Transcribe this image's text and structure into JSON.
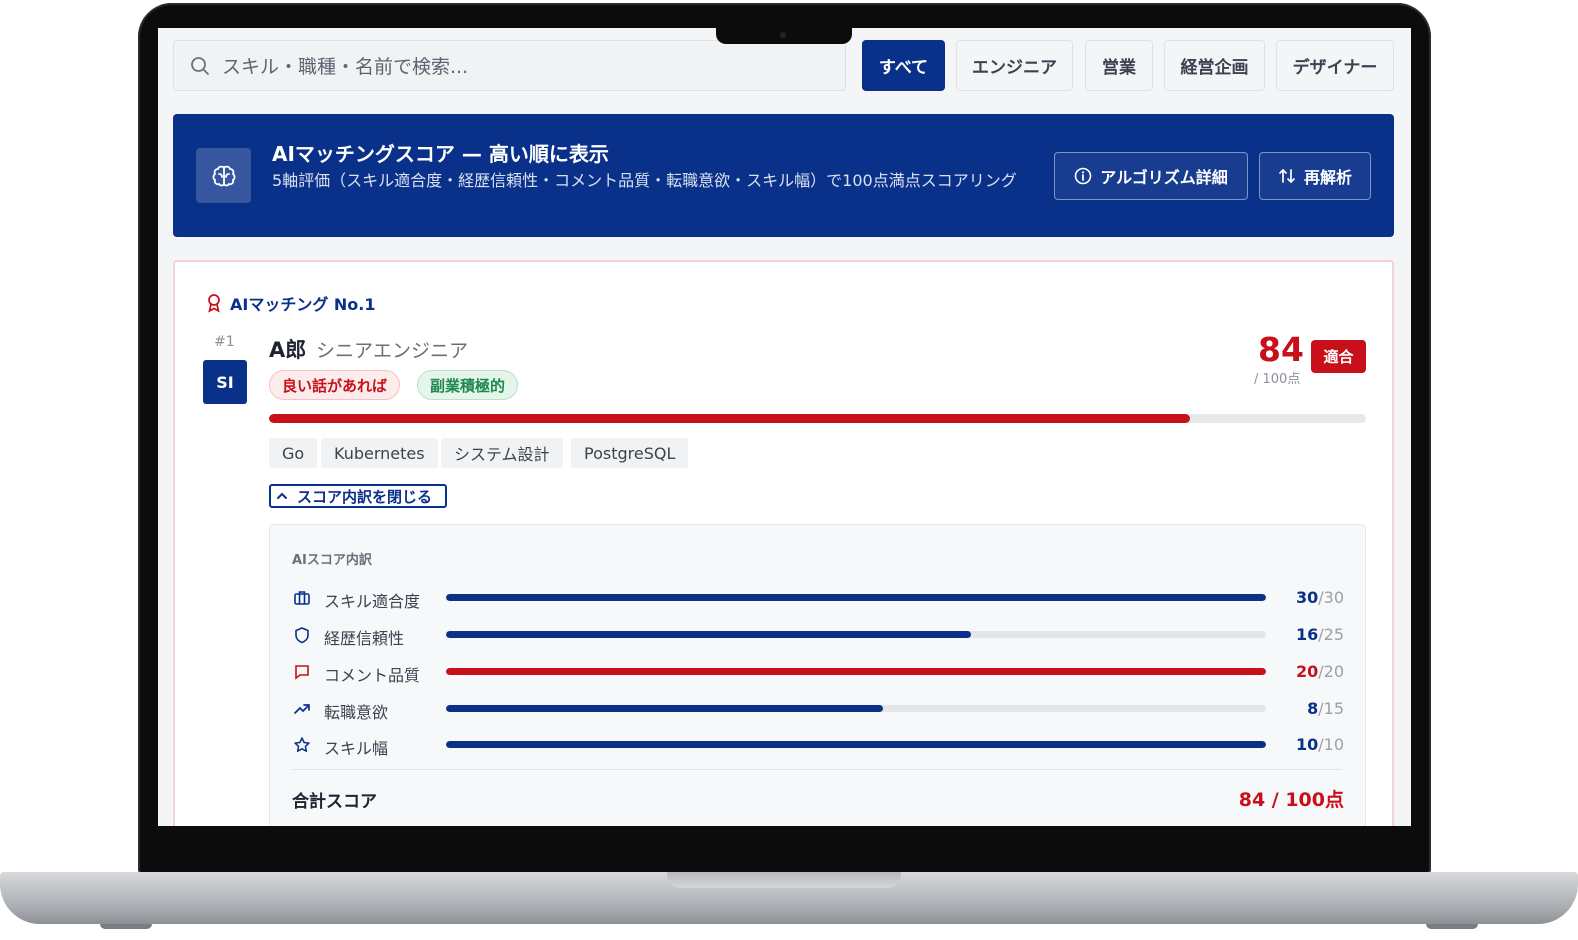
{
  "search": {
    "placeholder": "スキル・職種・名前で検索..."
  },
  "filters": [
    {
      "label": "すべて",
      "active": true
    },
    {
      "label": "エンジニア",
      "active": false
    },
    {
      "label": "営業",
      "active": false
    },
    {
      "label": "経営企画",
      "active": false
    },
    {
      "label": "デザイナー",
      "active": false
    }
  ],
  "banner": {
    "icon": "brain-icon",
    "title": "AIマッチングスコア — 高い順に表示",
    "subtitle": "5軸評価（スキル適合度・経歴信頼性・コメント品質・転職意欲・スキル幅）で100点満点スコアリング",
    "algorithm_button": "アルゴリズム詳細",
    "reanalyze_button": "再解析"
  },
  "candidate": {
    "badge_label": "AIマッチング No.1",
    "rank": "#1",
    "avatar_initials": "SI",
    "name": "A郎",
    "role": "シニアエンジニア",
    "tags": [
      "良い話があれば",
      "副業積極的"
    ],
    "score": "84",
    "score_max": "/ 100点",
    "score_fraction": 0.84,
    "fit_label": "適合",
    "skills": [
      "Go",
      "Kubernetes",
      "システム設計",
      "PostgreSQL"
    ],
    "toggle_label": "スコア内訳を閉じる"
  },
  "breakdown": {
    "title": "AIスコア内訳",
    "rows": [
      {
        "icon": "briefcase-icon",
        "label": "スキル適合度",
        "value": "30",
        "max": "/30",
        "color": "#0a318a"
      },
      {
        "icon": "shield-icon",
        "label": "経歴信頼性",
        "value": "16",
        "max": "/25",
        "color": "#0a318a"
      },
      {
        "icon": "comment-icon",
        "label": "コメント品質",
        "value": "20",
        "max": "/20",
        "color": "#c8101a"
      },
      {
        "icon": "trend-up-icon",
        "label": "転職意欲",
        "value": "8",
        "max": "/15",
        "color": "#0a318a"
      },
      {
        "icon": "star-icon",
        "label": "スキル幅",
        "value": "10",
        "max": "/10",
        "color": "#0a318a"
      }
    ],
    "total_label": "合計スコア",
    "total_value": "84 / 100点"
  },
  "colors": {
    "brand": "#0a318a",
    "accent": "#c8101a",
    "bar_track": "#e3e5ea"
  }
}
